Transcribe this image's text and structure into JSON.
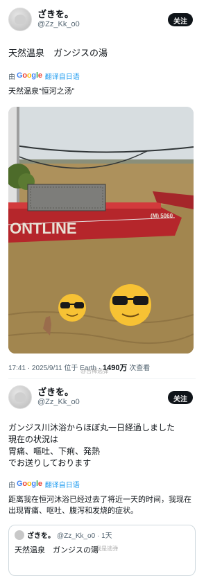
{
  "post1": {
    "display_name": "ざきを。",
    "handle": "@Zz_Kk_o0",
    "follow_label": "关注",
    "text": "天然温泉　ガンジスの湯",
    "translate": {
      "by": "由",
      "google": "Google",
      "label": "翻译自日语"
    },
    "translation": "天然温泉“恒河之汤”",
    "photo": {
      "boat_text": "ONTLINE",
      "boat_plate": "(M) 5060"
    },
    "meta": {
      "time": "17:41 · 2025/9/11 位于 Earth · ",
      "views": "1490万",
      "views_suffix": " 次查看"
    }
  },
  "post2": {
    "display_name": "ざきを。",
    "handle": "@Zz_Kk_o0",
    "follow_label": "关注",
    "text": "ガンジス川沐浴からほぼ丸一日経過しました\n現在の状況は\n胃痛、嘔吐、下痢、発熱\nでお送りしております",
    "translate": {
      "by": "由",
      "google": "Google",
      "label": "翻译自日语"
    },
    "translation": "距离我在恒河沐浴已经过去了将近一天的时间，我现在出现胃痛、呕吐、腹泻和发烧的症状。",
    "quote": {
      "name": "ざきを。",
      "meta": "@Zz_Kk_o0 · 1天",
      "text": "天然温泉　ガンジスの湯"
    }
  },
  "watermarks": [
    "@吉稀逃弹",
    "@我是逃弹"
  ],
  "colors": {
    "link": "#1d9bf0",
    "secondary": "#536471",
    "follow_bg": "#0f1419",
    "boat_red": "#b5262b"
  }
}
